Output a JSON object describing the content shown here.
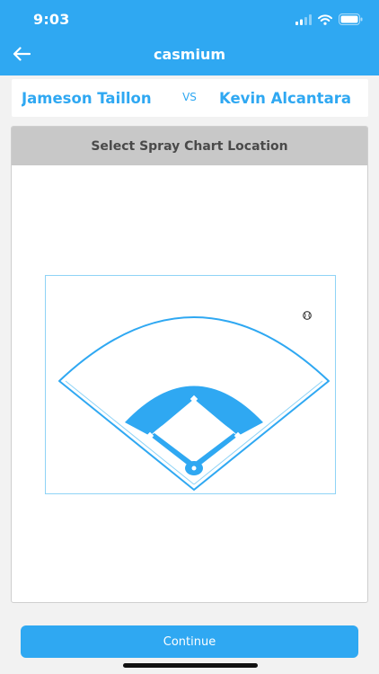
{
  "status_bar": {
    "time": "9:03"
  },
  "header": {
    "title": "casmium"
  },
  "matchup": {
    "home_player": "Jameson Taillon",
    "away_player": "Kevin Alcantara",
    "vs_label": "VS"
  },
  "spray_chart": {
    "header": "Select Spray Chart Location",
    "marker_icon": "baseball-icon",
    "field_color": "#2fa8f2"
  },
  "footer": {
    "continue_label": "Continue"
  },
  "colors": {
    "accent": "#2fa8f2",
    "panel_header": "#c8c8c8"
  }
}
